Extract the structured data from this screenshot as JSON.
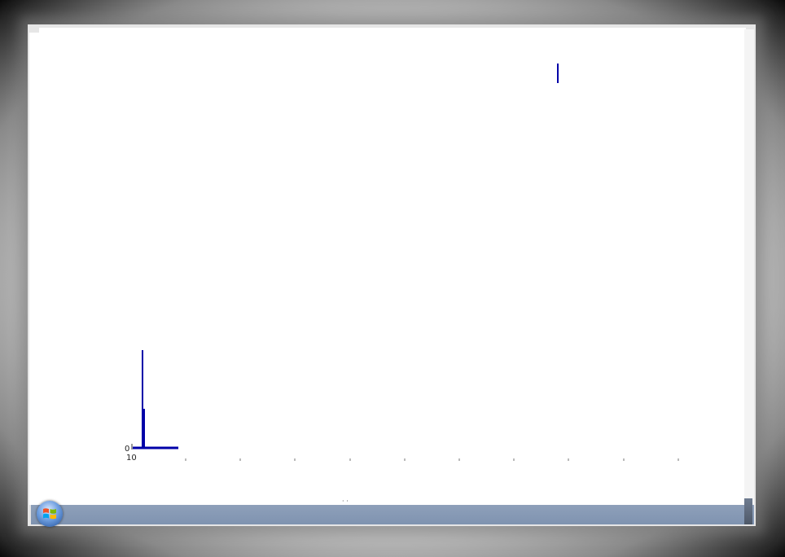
{
  "chart_data": {
    "type": "line",
    "title": "",
    "xlabel": "",
    "ylabel": "",
    "y_tick_labels": [
      "0"
    ],
    "x_tick_labels": [
      "10"
    ],
    "grid": false,
    "series": [
      {
        "values": [
          0,
          10,
          4
        ]
      }
    ],
    "series_color": "#0000a8"
  },
  "status_text": "· ·",
  "taskbar": {
    "color": "#8497b5",
    "start_icon": "windows-logo-icon"
  }
}
